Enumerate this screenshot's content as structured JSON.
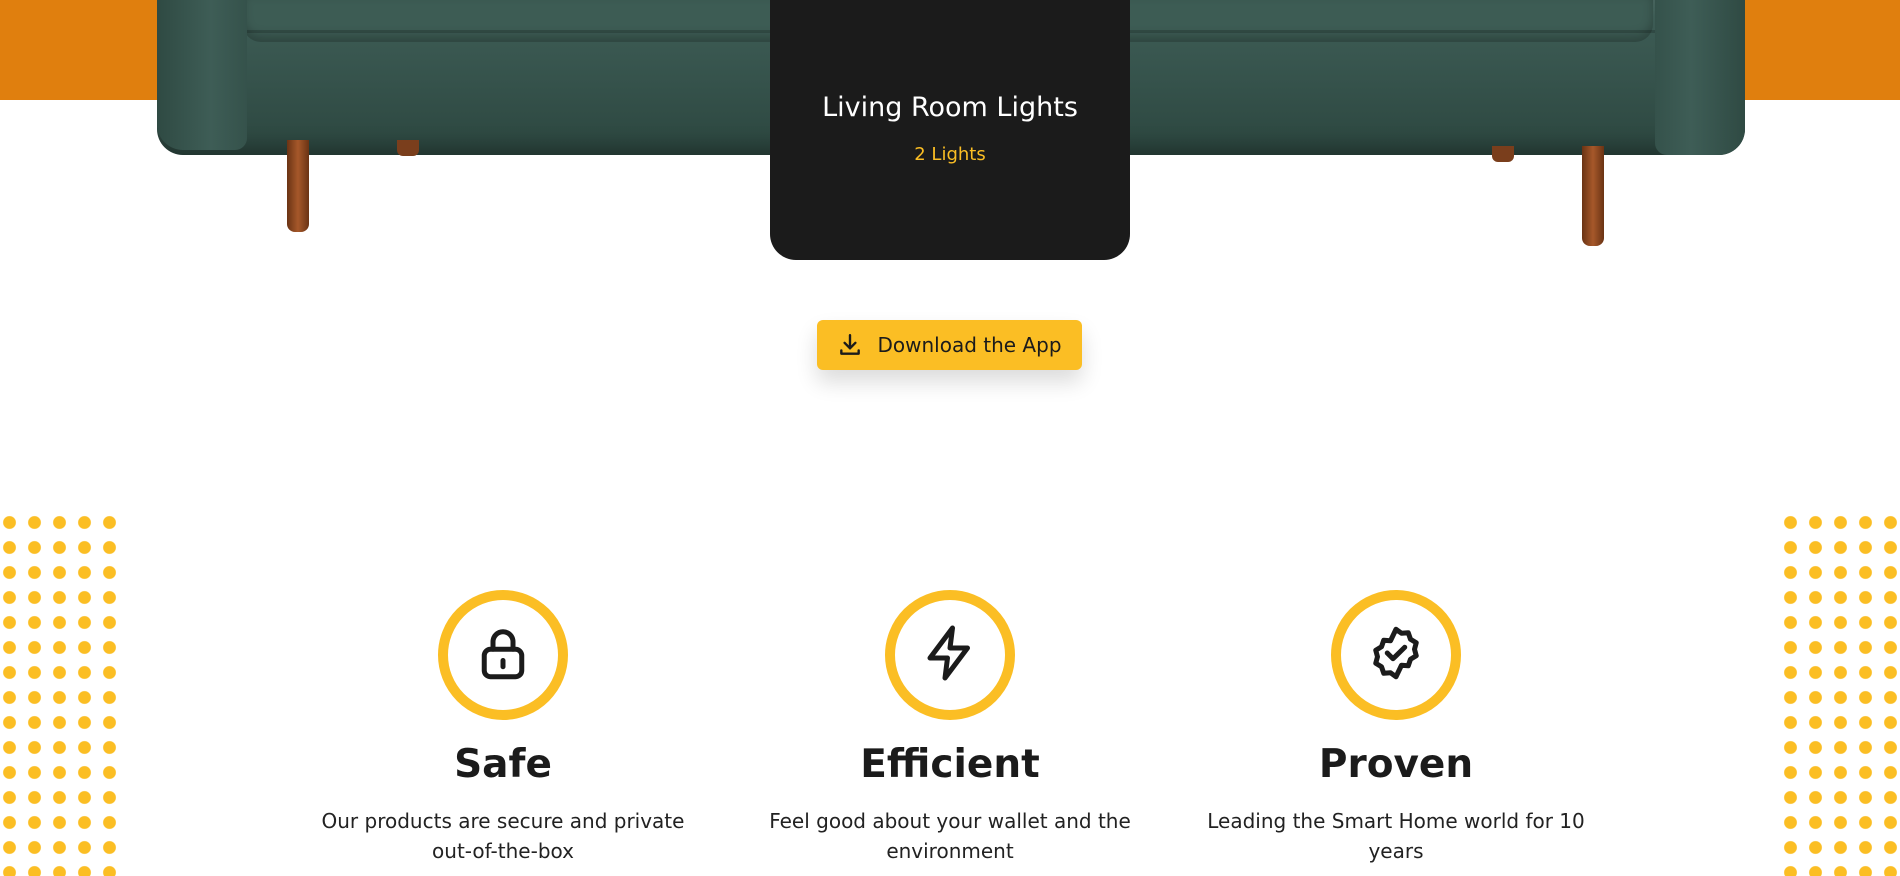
{
  "colors": {
    "accent": "#fbbe24",
    "orange_band": "#e07f0e",
    "card_bg": "#1b1b1b",
    "sofa": "#3d5c54"
  },
  "room_card": {
    "title": "Living Room Lights",
    "subtitle": "2 Lights"
  },
  "download": {
    "label": "Download the App",
    "icon": "download-icon"
  },
  "features": [
    {
      "icon": "lock-icon",
      "title": "Safe",
      "description": "Our products are secure and private out-of-the-box"
    },
    {
      "icon": "lightning-icon",
      "title": "Efficient",
      "description": "Feel good about your wallet and the environment"
    },
    {
      "icon": "badge-check-icon",
      "title": "Proven",
      "description": "Leading the Smart Home world for 10 years"
    }
  ]
}
